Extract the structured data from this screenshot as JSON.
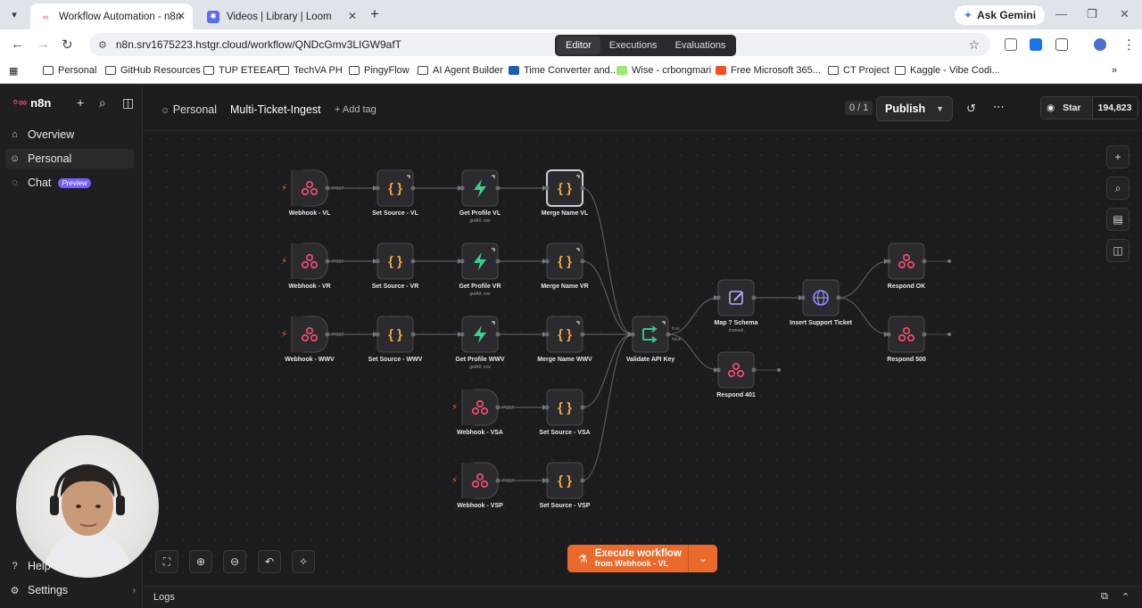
{
  "browser": {
    "tabs": [
      {
        "title": "Workflow Automation - n8n",
        "active": true
      },
      {
        "title": "Videos | Library | Loom",
        "active": false
      }
    ],
    "ask_gemini": "Ask Gemini",
    "url": "n8n.srv1675223.hstgr.cloud/workflow/QNDcGmv3LIGW9afT",
    "bookmarks": [
      "Personal",
      "GitHub Resources",
      "TUP ETEEAP",
      "TechVA PH",
      "PingyFlow",
      "AI Agent Builder",
      "Time Converter and...",
      "Wise - crbongmari",
      "Free Microsoft 365...",
      "CT Project",
      "Kaggle - Vibe Codi..."
    ]
  },
  "sidebar": {
    "brand": "n8n",
    "items": [
      {
        "label": "Overview",
        "icon": "home-icon"
      },
      {
        "label": "Personal",
        "icon": "user-icon"
      },
      {
        "label": "Chat",
        "icon": "chat-icon",
        "badge": "Preview"
      }
    ],
    "help": "Help",
    "settings": "Settings"
  },
  "header": {
    "project": "Personal",
    "workflow_name": "Multi-Ticket-Ingest",
    "add_tag": "+ Add tag",
    "counter": "0 / 1",
    "publish": "Publish",
    "star_label": "Star",
    "star_count": "194,823"
  },
  "view_tabs": [
    "Editor",
    "Executions",
    "Evaluations"
  ],
  "nodes": [
    {
      "id": "wvl",
      "label": "Webhook - VL",
      "type": "webhook",
      "tag": "POST"
    },
    {
      "id": "svl",
      "label": "Set Source - VL",
      "type": "set"
    },
    {
      "id": "gvl",
      "label": "Get Profile VL",
      "type": "supabase",
      "sub": "getAll: row"
    },
    {
      "id": "mvl",
      "label": "Merge Name VL",
      "type": "set"
    },
    {
      "id": "wvr",
      "label": "Webhook - VR",
      "type": "webhook",
      "tag": "POST"
    },
    {
      "id": "svr",
      "label": "Set Source - VR",
      "type": "set"
    },
    {
      "id": "gvr",
      "label": "Get Profile VR",
      "type": "supabase",
      "sub": "getAll: row"
    },
    {
      "id": "mvr",
      "label": "Merge Name VR",
      "type": "set"
    },
    {
      "id": "wwv",
      "label": "Webhook - WWV",
      "type": "webhook",
      "tag": "POST"
    },
    {
      "id": "swv",
      "label": "Set Source - WWV",
      "type": "set"
    },
    {
      "id": "gwv",
      "label": "Get Profile WWV",
      "type": "supabase",
      "sub": "getAll: row"
    },
    {
      "id": "mwv",
      "label": "Merge Name WWV",
      "type": "set"
    },
    {
      "id": "wvs",
      "label": "Webhook - VSA",
      "type": "webhook",
      "tag": "POST"
    },
    {
      "id": "svs",
      "label": "Set Source - VSA",
      "type": "set"
    },
    {
      "id": "wvp",
      "label": "Webhook - VSP",
      "type": "webhook",
      "tag": "POST"
    },
    {
      "id": "svp",
      "label": "Set Source - VSP",
      "type": "set"
    },
    {
      "id": "val",
      "label": "Validate API Key",
      "type": "if",
      "outputs": [
        "true",
        "false"
      ]
    },
    {
      "id": "map",
      "label": "Map ? Schema",
      "type": "edit",
      "sub": "manual"
    },
    {
      "id": "ins",
      "label": "Insert Support Ticket",
      "type": "http"
    },
    {
      "id": "rok",
      "label": "Respond OK",
      "type": "webhook"
    },
    {
      "id": "r500",
      "label": "Respond 500",
      "type": "webhook"
    },
    {
      "id": "r401",
      "label": "Respond 401",
      "type": "webhook"
    }
  ],
  "execute": {
    "label": "Execute workflow",
    "sub": "from Webhook - VL"
  },
  "logs": "Logs",
  "colors": {
    "accent": "#ea6a2b",
    "webhook": "#ea4b71",
    "set": "#f0a640",
    "supabase": "#3ecf8e",
    "if": "#35c48a",
    "edit": "#b9a6ff",
    "http": "#8f8cff"
  }
}
